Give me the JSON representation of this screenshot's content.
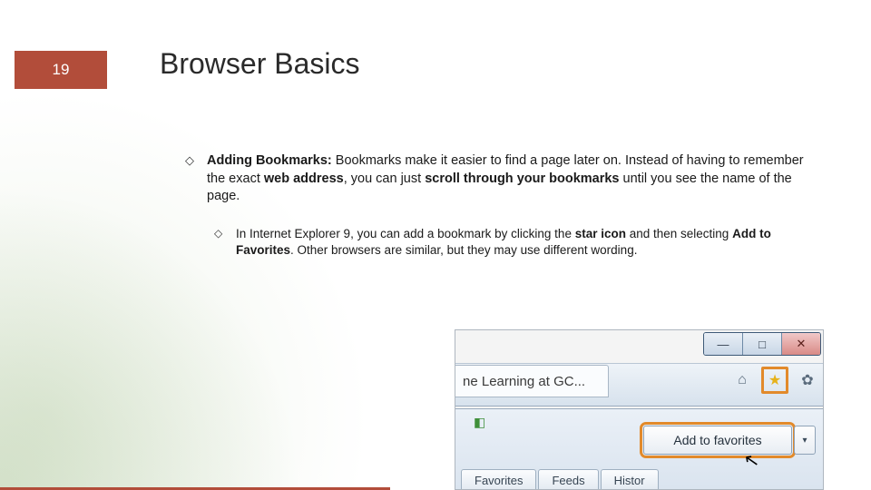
{
  "slide": {
    "number": "19",
    "title": "Browser Basics"
  },
  "bullets": {
    "b1_lead": "Adding Bookmarks:",
    "b1_rest_a": " Bookmarks make it easier to find a page later on. Instead of having to remember the exact ",
    "b1_bold_a": "web address",
    "b1_rest_b": ", you can just ",
    "b1_bold_b": "scroll through your bookmarks",
    "b1_rest_c": " until you see the name of the page.",
    "b2_a": " In Internet Explorer 9, you can add a bookmark by clicking the ",
    "b2_bold_a": "star icon",
    "b2_b": " and then selecting ",
    "b2_bold_b": "Add to Favorites",
    "b2_c": ". Other browsers are similar, but they may use different wording."
  },
  "shot": {
    "tab_text": "ne Learning at GC...",
    "home_icon": "⌂",
    "star_icon": "★",
    "gear_icon": "✿",
    "min": "—",
    "max": "□",
    "close": "✕",
    "pin": "◧",
    "add_fav": "Add to favorites",
    "split": "▾",
    "cursor": "↖",
    "tab1": "Favorites",
    "tab2": "Feeds",
    "tab3": "Histor"
  }
}
